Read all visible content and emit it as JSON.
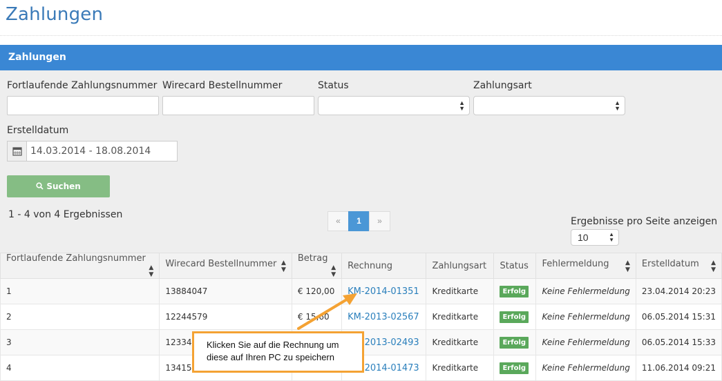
{
  "page": {
    "title": "Zahlungen"
  },
  "panel": {
    "title": "Zahlungen"
  },
  "filters": {
    "seq_number_label": "Fortlaufende Zahlungsnummer",
    "wirecard_label": "Wirecard Bestellnummer",
    "status_label": "Status",
    "payment_type_label": "Zahlungsart",
    "created_label": "Erstelldatum",
    "date_range_value": "14.03.2014 - 18.08.2014",
    "search_label": "Suchen"
  },
  "results": {
    "count_text": "1 - 4 von 4 Ergebnissen",
    "per_page_label": "Ergebnisse pro Seite anzeigen",
    "per_page_value": "10"
  },
  "pagination": {
    "prev": "«",
    "current": "1",
    "next": "»"
  },
  "table": {
    "headers": [
      "Fortlaufende Zahlungsnummer",
      "Wirecard Bestellnummer",
      "Betrag",
      "Rechnung",
      "Zahlungsart",
      "Status",
      "Fehlermeldung",
      "Erstelldatum"
    ],
    "rows": [
      [
        "1",
        "13884047",
        "€ 120,00",
        "KM-2014-01351",
        "Kreditkarte",
        "Erfolg",
        "Keine Fehlermeldung",
        "23.04.2014 20:23"
      ],
      [
        "2",
        "12244579",
        "€ 15,60",
        "KM-2013-02567",
        "Kreditkarte",
        "Erfolg",
        "Keine Fehlermeldung",
        "06.05.2014 15:31"
      ],
      [
        "3",
        "12334",
        "",
        "KM-2013-02493",
        "Kreditkarte",
        "Erfolg",
        "Keine Fehlermeldung",
        "06.05.2014 15:33"
      ],
      [
        "4",
        "13415",
        "",
        "KM-2014-01473",
        "Kreditkarte",
        "Erfolg",
        "Keine Fehlermeldung",
        "11.06.2014 09:21"
      ]
    ]
  },
  "callout": {
    "line1": "Klicken Sie auf die Rechnung um",
    "line2": "diese auf Ihren PC zu speichern"
  },
  "colors": {
    "header_blue": "#3a87d4",
    "success": "#5aa85b",
    "callout_border": "#f4a233",
    "search_button": "#85bd84"
  }
}
